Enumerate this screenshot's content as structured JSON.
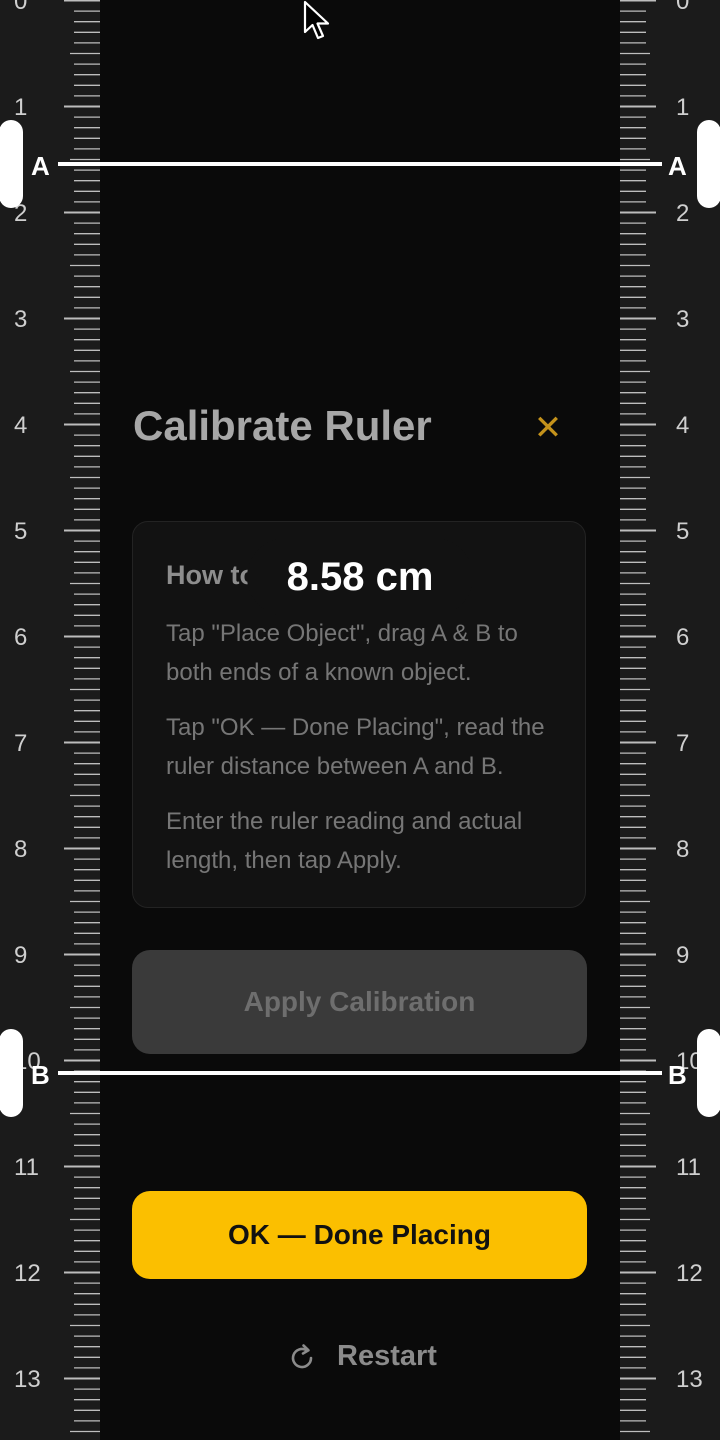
{
  "ruler": {
    "numbers": [
      "0",
      "1",
      "2",
      "3",
      "4",
      "5",
      "6",
      "7",
      "8",
      "9",
      "10",
      "11",
      "12",
      "13"
    ],
    "background_color": "#1b1b1b",
    "tick_color": "#bdbdbd"
  },
  "markers": {
    "a": {
      "label": "A"
    },
    "b": {
      "label": "B"
    }
  },
  "measurement": {
    "value": "8.58 cm"
  },
  "dialog": {
    "title": "Calibrate Ruler",
    "close_icon": "close-x-icon",
    "info_heading": "How to calibrate",
    "steps": [
      "Tap \"Place Object\", drag A & B to both ends of a known object.",
      "Tap \"OK — Done Placing\", read the ruler distance between A and B.",
      "Enter the ruler reading and actual length, then tap Apply."
    ],
    "apply_label": "Apply Calibration"
  },
  "actions": {
    "done_label": "OK — Done Placing",
    "restart_label": "Restart",
    "restart_icon": "refresh-icon"
  },
  "colors": {
    "accent": "#fbbf00",
    "close": "#c4921b",
    "marker": "#ffffff",
    "disabled_button": "#3a3a3a"
  }
}
